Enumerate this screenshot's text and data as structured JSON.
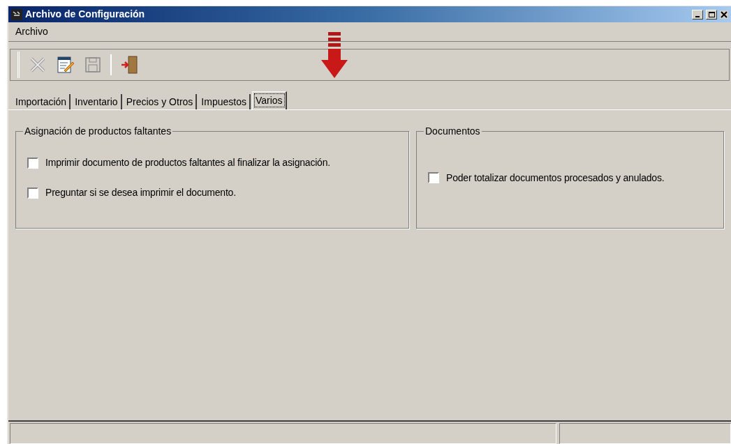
{
  "window": {
    "title": "Archivo de Configuración"
  },
  "menu": [
    "Archivo"
  ],
  "tabs": [
    {
      "label": "Importación",
      "selected": false
    },
    {
      "label": "Inventario",
      "selected": false
    },
    {
      "label": "Precios y Otros",
      "selected": false
    },
    {
      "label": "Impuestos",
      "selected": false
    },
    {
      "label": "Varios",
      "selected": true
    }
  ],
  "groups": [
    {
      "title": "Asignación de productos faltantes",
      "options": [
        {
          "label": "Imprimir documento de productos faltantes al finalizar la asignación.",
          "checked": false
        },
        {
          "label": "Preguntar si se desea imprimir el documento.",
          "checked": false
        }
      ]
    },
    {
      "title": "Documentos",
      "options": [
        {
          "label": "Poder totalizar documentos procesados y anulados.",
          "checked": false
        }
      ]
    }
  ]
}
